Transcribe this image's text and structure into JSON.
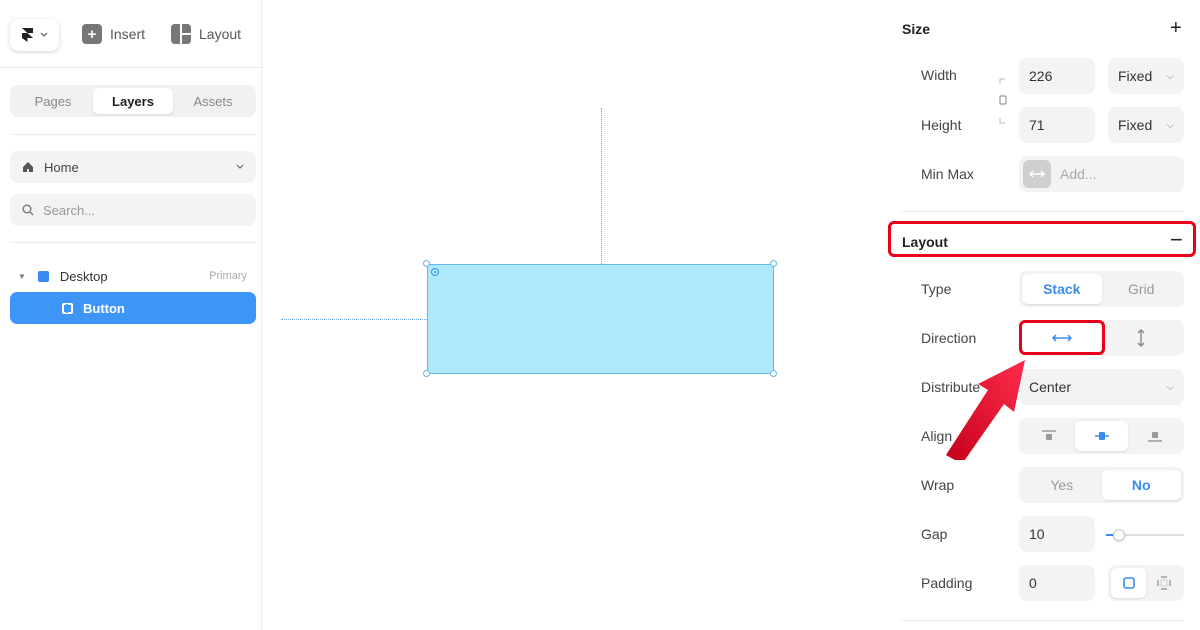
{
  "toolbar": {
    "insert_label": "Insert",
    "layout_label": "Layout"
  },
  "left_tabs": [
    "Pages",
    "Layers",
    "Assets"
  ],
  "page_select": {
    "label": "Home"
  },
  "search": {
    "placeholder": "Search..."
  },
  "layers": [
    {
      "name": "Desktop",
      "tag": "Primary"
    },
    {
      "name": "Button",
      "selected": true
    }
  ],
  "size_section": {
    "title": "Size",
    "width_label": "Width",
    "width_value": "226",
    "width_mode": "Fixed",
    "height_label": "Height",
    "height_value": "71",
    "height_mode": "Fixed",
    "minmax_label": "Min Max",
    "minmax_placeholder": "Add..."
  },
  "layout_section": {
    "title": "Layout",
    "type_label": "Type",
    "type_options": [
      "Stack",
      "Grid"
    ],
    "type_selected": "Stack",
    "direction_label": "Direction",
    "direction_selected": "horizontal",
    "distribute_label": "Distribute",
    "distribute_value": "Center",
    "align_label": "Align",
    "align_selected": "center",
    "wrap_label": "Wrap",
    "wrap_options": [
      "Yes",
      "No"
    ],
    "wrap_selected": "No",
    "gap_label": "Gap",
    "gap_value": "10",
    "padding_label": "Padding",
    "padding_value": "0"
  },
  "colors": {
    "accent": "#3a8bf0",
    "selection_fill": "#aeeafb",
    "annotation": "#e8001c"
  }
}
